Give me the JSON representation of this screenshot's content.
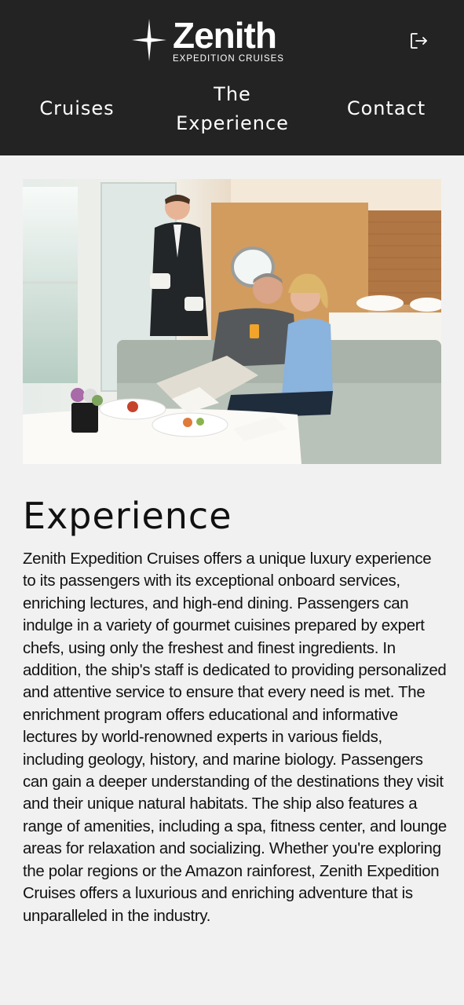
{
  "brand": {
    "name": "Zenith",
    "subtitle": "EXPEDITION CRUISES",
    "logo_icon": "four-point-star-icon"
  },
  "header": {
    "logout_icon": "logout-icon"
  },
  "nav": {
    "items": [
      {
        "label": "Cruises"
      },
      {
        "label": "The Experience"
      },
      {
        "label": "Contact"
      }
    ]
  },
  "hero": {
    "alt": "Butler serving a couple in a luxury cruise suite"
  },
  "main": {
    "title": "Experience",
    "body": "Zenith Expedition Cruises offers a unique luxury experience to its passengers with its exceptional onboard services, enriching lectures, and high-end dining. Passengers can indulge in a variety of gourmet cuisines prepared by expert chefs, using only the freshest and finest ingredients. In addition, the ship's staff is dedicated to providing personalized and attentive service to ensure that every need is met. The enrichment program offers educational and informative lectures by world-renowned experts in various fields, including geology, history, and marine biology. Passengers can gain a deeper understanding of the destinations they visit and their unique natural habitats. The ship also features a range of amenities, including a spa, fitness center, and lounge areas for relaxation and socializing. Whether you're exploring the polar regions or the Amazon rainforest, Zenith Expedition Cruises offers a luxurious and enriching adventure that is unparalleled in the industry."
  },
  "colors": {
    "header_bg": "#232323",
    "page_bg": "#f1f1f1",
    "text": "#111111"
  }
}
